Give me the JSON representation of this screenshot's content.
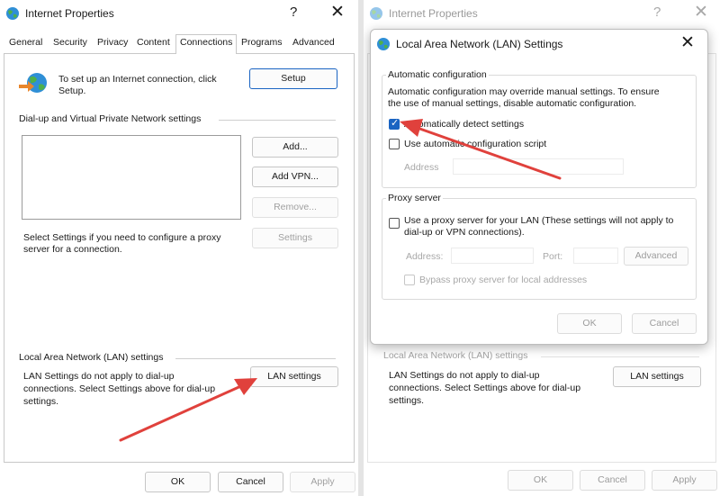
{
  "left_window": {
    "title": "Internet Properties",
    "help_glyph": "?",
    "close_glyph": "✕",
    "tabs": [
      "General",
      "Security",
      "Privacy",
      "Content",
      "Connections",
      "Programs",
      "Advanced"
    ],
    "active_tab": "Connections",
    "setup_text_line1": "To set up an Internet connection, click",
    "setup_text_line2": "Setup.",
    "setup_button": "Setup",
    "dialup_group": "Dial-up and Virtual Private Network settings",
    "add_button": "Add...",
    "add_vpn_button": "Add VPN...",
    "remove_button": "Remove...",
    "settings_text_line1": "Select Settings if you need to configure a proxy",
    "settings_text_line2": "server for a connection.",
    "settings_button": "Settings",
    "lan_group": "Local Area Network (LAN) settings",
    "lan_text_line1": "LAN Settings do not apply to dial-up",
    "lan_text_line2": "connections. Select Settings above for dial-up",
    "lan_text_line3": "settings.",
    "lan_settings_button": "LAN settings",
    "ok_button": "OK",
    "cancel_button": "Cancel",
    "apply_button": "Apply"
  },
  "right_window": {
    "title": "Internet Properties",
    "help_glyph": "?",
    "close_glyph": "✕",
    "lan_group": "Local Area Network (LAN) settings",
    "lan_text_line1": "LAN Settings do not apply to dial-up",
    "lan_text_line2": "connections. Select Settings above for dial-up",
    "lan_text_line3": "settings.",
    "lan_settings_button": "LAN settings",
    "ok_button": "OK",
    "cancel_button": "Cancel",
    "apply_button": "Apply"
  },
  "lan_dialog": {
    "title": "Local Area Network (LAN) Settings",
    "close_glyph": "✕",
    "auto_group": "Automatic configuration",
    "auto_desc_line1": "Automatic configuration may override manual settings.  To ensure",
    "auto_desc_line2": "the use of manual settings, disable automatic configuration.",
    "auto_detect_label": "Automatically detect settings",
    "auto_detect_checked": true,
    "use_script_label": "Use automatic configuration script",
    "use_script_checked": false,
    "address_label": "Address",
    "proxy_group": "Proxy server",
    "use_proxy_line1": "Use a proxy server for your LAN (These settings will not apply to",
    "use_proxy_line2": "dial-up or VPN connections).",
    "use_proxy_checked": false,
    "proxy_address_label": "Address:",
    "port_label": "Port:",
    "advanced_button": "Advanced",
    "bypass_label": "Bypass proxy server for local addresses",
    "bypass_checked": false,
    "ok_button": "OK",
    "cancel_button": "Cancel"
  },
  "colors": {
    "accent": "#1a64c2",
    "annotation_arrow": "#e0413c"
  }
}
